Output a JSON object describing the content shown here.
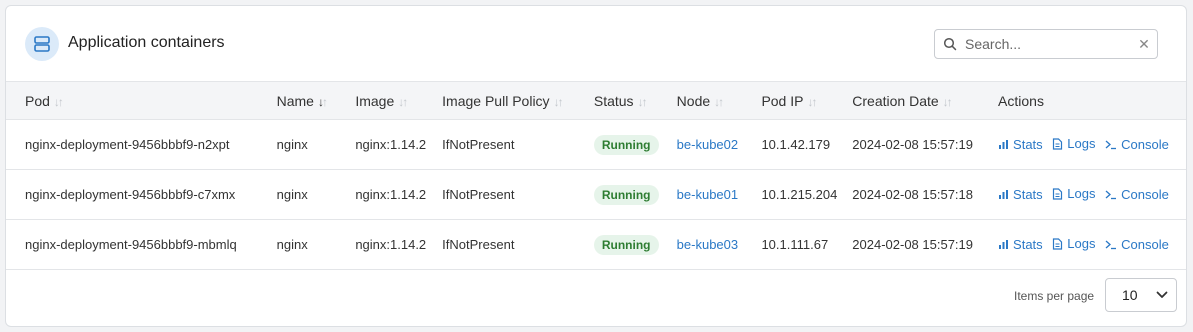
{
  "header": {
    "title": "Application containers",
    "icon": "server-icon"
  },
  "search": {
    "placeholder": "Search...",
    "value": ""
  },
  "table": {
    "columns": [
      "Pod",
      "Name",
      "Image",
      "Image Pull Policy",
      "Status",
      "Node",
      "Pod IP",
      "Creation Date",
      "Actions"
    ],
    "sorted_column": "Name",
    "sort_direction": "desc",
    "rows": [
      {
        "pod": "nginx-deployment-9456bbbf9-n2xpt",
        "name": "nginx",
        "image": "nginx:1.14.2",
        "pull_policy": "IfNotPresent",
        "status": "Running",
        "node": "be-kube02",
        "pod_ip": "10.1.42.179",
        "created": "2024-02-08 15:57:19"
      },
      {
        "pod": "nginx-deployment-9456bbbf9-c7xmx",
        "name": "nginx",
        "image": "nginx:1.14.2",
        "pull_policy": "IfNotPresent",
        "status": "Running",
        "node": "be-kube01",
        "pod_ip": "10.1.215.204",
        "created": "2024-02-08 15:57:18"
      },
      {
        "pod": "nginx-deployment-9456bbbf9-mbmlq",
        "name": "nginx",
        "image": "nginx:1.14.2",
        "pull_policy": "IfNotPresent",
        "status": "Running",
        "node": "be-kube03",
        "pod_ip": "10.1.111.67",
        "created": "2024-02-08 15:57:19"
      }
    ],
    "actions": {
      "stats": "Stats",
      "logs": "Logs",
      "console": "Console"
    }
  },
  "pagination": {
    "items_per_page_label": "Items per page",
    "items_per_page_value": "10"
  },
  "colors": {
    "accent": "#2a78c6",
    "status_running_bg": "#e6f4ea",
    "status_running_text": "#2e7d32"
  }
}
